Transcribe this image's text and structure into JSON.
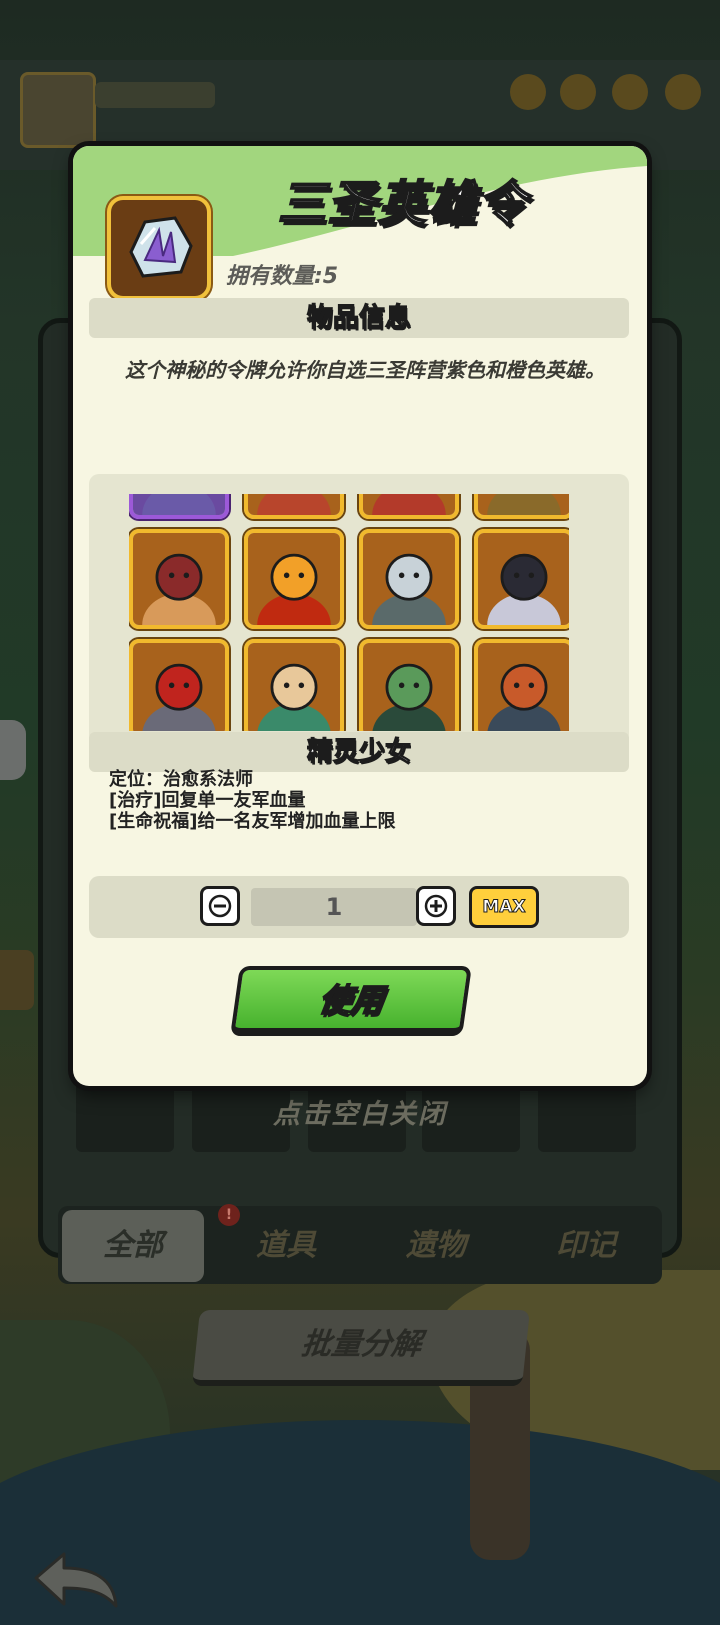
{
  "modal": {
    "title": "三圣英雄令",
    "owned_label": "拥有数量:5",
    "info_section_title": "物品信息",
    "description": "这个神秘的令牌允许你自选三圣阵营紫色和橙色英雄。",
    "selected_hero": {
      "name": "精灵少女",
      "desc_lines": [
        "定位：治愈系法师",
        "[治疗]回复单一友军血量",
        "[生命祝福]给一名友军增加血量上限"
      ]
    },
    "heroes": [
      {
        "name": "hero-armored-knight",
        "rarity": "purple"
      },
      {
        "name": "hero-blue-warrior",
        "rarity": "orange"
      },
      {
        "name": "hero-white-cleric",
        "rarity": "orange"
      },
      {
        "name": "hero-gold-paladin",
        "rarity": "orange"
      },
      {
        "name": "hero-minotaur",
        "rarity": "orange"
      },
      {
        "name": "hero-fire-golem",
        "rarity": "orange"
      },
      {
        "name": "hero-tree-ent",
        "rarity": "orange"
      },
      {
        "name": "hero-dark-witch",
        "rarity": "orange"
      },
      {
        "name": "hero-red-hood-assassin",
        "rarity": "orange"
      },
      {
        "name": "hero-elf-maiden-bard",
        "rarity": "orange"
      },
      {
        "name": "hero-frog-brute",
        "rarity": "orange"
      },
      {
        "name": "hero-dwarf-engineer",
        "rarity": "orange"
      }
    ],
    "quantity": "1",
    "max_label": "MAX",
    "use_label": "使用"
  },
  "close_hint": "点击空白关闭",
  "bag": {
    "tabs": [
      "全部",
      "道具",
      "遗物",
      "印记"
    ],
    "active_tab": "全部",
    "tab_badge": "!",
    "bulk_button": "批量分解"
  },
  "colors": {
    "modal_bg": "#f7f6e2",
    "header_green": "#9fd67a",
    "gold_frame": "#f1b92d",
    "purple_frame": "#9c59d8",
    "use_green": "#5cc43a",
    "max_yellow": "#ffcf3c"
  }
}
